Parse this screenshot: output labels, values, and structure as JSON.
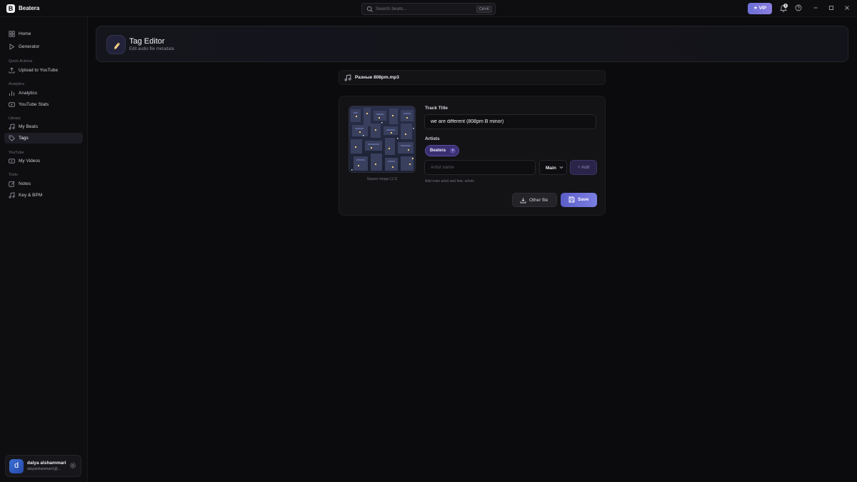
{
  "app": {
    "logo_letter": "B",
    "name": "Beatera"
  },
  "titlebar": {
    "search_placeholder": "Search beats...",
    "search_shortcut": "Ctrl+K",
    "vip_label": "★ VIP",
    "notification_count": "1",
    "icons": [
      "search-icon",
      "bell-icon",
      "help-icon",
      "minimize-icon",
      "maximize-icon",
      "close-icon"
    ]
  },
  "sidebar": {
    "items": [
      {
        "label": "Home",
        "icon": "grid-icon"
      },
      {
        "label": "Generator",
        "icon": "play-icon"
      },
      {
        "label": "Upload to YouTube",
        "icon": "upload-icon"
      },
      {
        "label": "Analytics",
        "icon": "bar-chart-icon"
      },
      {
        "label": "YouTube Stats",
        "icon": "youtube-icon"
      },
      {
        "label": "My Beats",
        "icon": "music-note-icon"
      },
      {
        "label": "Tags",
        "icon": "tag-icon",
        "active": true
      },
      {
        "label": "My Videos",
        "icon": "youtube-icon"
      },
      {
        "label": "Notes",
        "icon": "edit-icon"
      },
      {
        "label": "Key & BPM",
        "icon": "music-note-icon"
      }
    ],
    "sections": {
      "quick_actions": "Quick Actions",
      "analytics": "Analytics",
      "library": "Library",
      "youtube": "YouTube",
      "tools": "Tools"
    }
  },
  "user": {
    "initial": "d",
    "name": "dalya alshammari",
    "email": "dalyalshammari1@..."
  },
  "header": {
    "title": "Tag Editor",
    "subtitle": "Edit audio file metadata",
    "icon": "tag-icon"
  },
  "file": {
    "name": "Разные 808pm.mp3",
    "icon": "music-note-icon"
  },
  "editor": {
    "cover_caption": "Square image (1:1)",
    "track_title_label": "Track Title",
    "track_title_value": "we are different (808pm B minor)",
    "artists_label": "Artists",
    "artist_chips": [
      "Beatera"
    ],
    "artist_input_placeholder": "Artist name",
    "role_value": "Main",
    "add_label": "+ Add",
    "helper_text": "Add main artist and feat. artists",
    "other_file_label": "Other file",
    "save_label": "Save"
  },
  "colors": {
    "background": "#0b0b0d",
    "accent": "#6b6fd6",
    "chip": "#3a2f70"
  }
}
